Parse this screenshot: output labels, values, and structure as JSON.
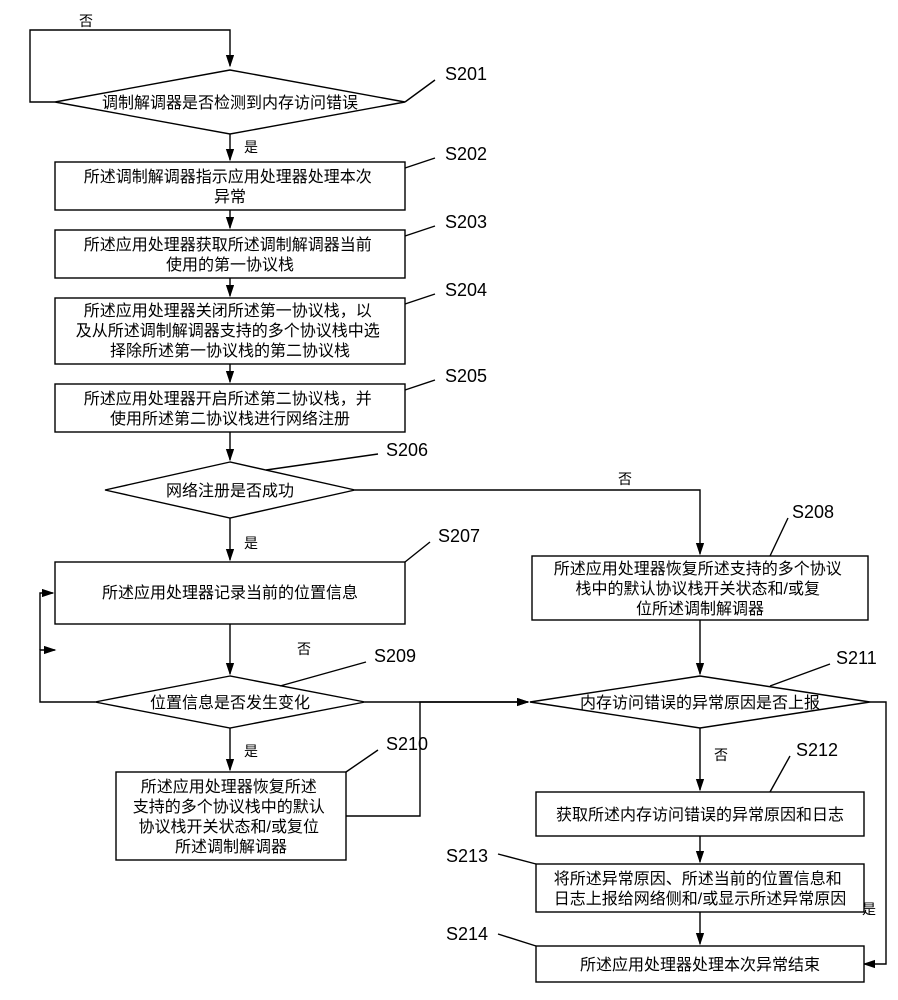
{
  "chart_data": {
    "type": "flowchart",
    "title": "",
    "nodes": [
      {
        "id": "S201",
        "type": "decision",
        "text": "调制解调器是否检测到内存访问错误",
        "label": "S201"
      },
      {
        "id": "S202",
        "type": "process",
        "text": "所述调制解调器指示应用处理器处理本次异常",
        "label": "S202"
      },
      {
        "id": "S203",
        "type": "process",
        "text": "所述应用处理器获取所述调制解调器当前使用的第一协议栈",
        "label": "S203"
      },
      {
        "id": "S204",
        "type": "process",
        "text": "所述应用处理器关闭所述第一协议栈，以及从所述调制解调器支持的多个协议栈中选择除所述第一协议栈的第二协议栈",
        "label": "S204"
      },
      {
        "id": "S205",
        "type": "process",
        "text": "所述应用处理器开启所述第二协议栈，并使用所述第二协议栈进行网络注册",
        "label": "S205"
      },
      {
        "id": "S206",
        "type": "decision",
        "text": "网络注册是否成功",
        "label": "S206"
      },
      {
        "id": "S207",
        "type": "process",
        "text": "所述应用处理器记录当前的位置信息",
        "label": "S207"
      },
      {
        "id": "S208",
        "type": "process",
        "text": "所述应用处理器恢复所述支持的多个协议栈中的默认协议栈开关状态和/或复位所述调制解调器",
        "label": "S208"
      },
      {
        "id": "S209",
        "type": "decision",
        "text": "位置信息是否发生变化",
        "label": "S209"
      },
      {
        "id": "S210",
        "type": "process",
        "text": "所述应用处理器恢复所述支持的多个协议栈中的默认协议栈开关状态和/或复位所述调制解调器",
        "label": "S210"
      },
      {
        "id": "S211",
        "type": "decision",
        "text": "内存访问错误的异常原因是否上报",
        "label": "S211"
      },
      {
        "id": "S212",
        "type": "process",
        "text": "获取所述内存访问错误的异常原因和日志",
        "label": "S212"
      },
      {
        "id": "S213",
        "type": "process",
        "text": "将所述异常原因、所述当前的位置信息和日志上报给网络侧和/或显示所述异常原因",
        "label": "S213"
      },
      {
        "id": "S214",
        "type": "process",
        "text": "所述应用处理器处理本次异常结束",
        "label": "S214"
      }
    ],
    "edges": [
      {
        "from": "S201",
        "to": "S201",
        "label": "否"
      },
      {
        "from": "S201",
        "to": "S202",
        "label": "是"
      },
      {
        "from": "S202",
        "to": "S203",
        "label": ""
      },
      {
        "from": "S203",
        "to": "S204",
        "label": ""
      },
      {
        "from": "S204",
        "to": "S205",
        "label": ""
      },
      {
        "from": "S205",
        "to": "S206",
        "label": ""
      },
      {
        "from": "S206",
        "to": "S207",
        "label": "是"
      },
      {
        "from": "S206",
        "to": "S208",
        "label": "否"
      },
      {
        "from": "S207",
        "to": "S209",
        "label": ""
      },
      {
        "from": "S208",
        "to": "S211",
        "label": ""
      },
      {
        "from": "S209",
        "to": "S210",
        "label": "是"
      },
      {
        "from": "S209",
        "to": "S211",
        "label": "否"
      },
      {
        "from": "S210",
        "to": "S211",
        "label": ""
      },
      {
        "from": "S211",
        "to": "S212",
        "label": "否"
      },
      {
        "from": "S211",
        "to": "S214",
        "label": "是"
      },
      {
        "from": "S212",
        "to": "S213",
        "label": ""
      },
      {
        "from": "S213",
        "to": "S214",
        "label": ""
      }
    ],
    "labels": {
      "yes": "是",
      "no": "否"
    }
  }
}
